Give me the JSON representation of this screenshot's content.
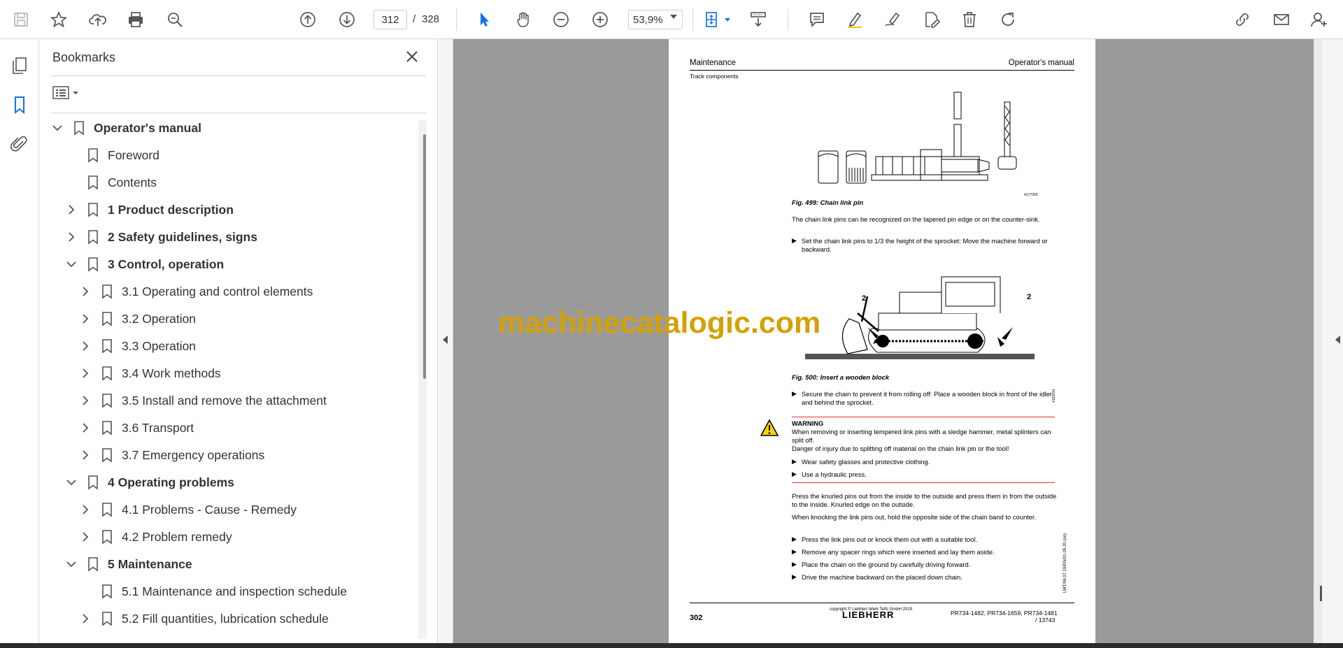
{
  "toolbar": {
    "page_current": "312",
    "page_separator": "/",
    "page_total": "328",
    "zoom": "53,9%"
  },
  "panel": {
    "title": "Bookmarks"
  },
  "bookmarks": [
    {
      "label": "Operator's manual",
      "level": 0,
      "expander": "expanded",
      "bold": true
    },
    {
      "label": "Foreword",
      "level": 1,
      "expander": "none",
      "bold": false
    },
    {
      "label": "Contents",
      "level": 1,
      "expander": "none",
      "bold": false
    },
    {
      "label": "1 Product description",
      "level": 1,
      "expander": "collapsed",
      "bold": true
    },
    {
      "label": "2 Safety guidelines, signs",
      "level": 1,
      "expander": "collapsed",
      "bold": true
    },
    {
      "label": "3 Control, operation",
      "level": 1,
      "expander": "expanded",
      "bold": true
    },
    {
      "label": "3.1 Operating and control elements",
      "level": 2,
      "expander": "collapsed",
      "bold": false
    },
    {
      "label": "3.2 Operation",
      "level": 2,
      "expander": "collapsed",
      "bold": false
    },
    {
      "label": "3.3 Operation",
      "level": 2,
      "expander": "collapsed",
      "bold": false
    },
    {
      "label": "3.4 Work methods",
      "level": 2,
      "expander": "collapsed",
      "bold": false
    },
    {
      "label": "3.5 Install and remove the attachment",
      "level": 2,
      "expander": "collapsed",
      "bold": false
    },
    {
      "label": "3.6 Transport",
      "level": 2,
      "expander": "collapsed",
      "bold": false
    },
    {
      "label": "3.7 Emergency operations",
      "level": 2,
      "expander": "collapsed",
      "bold": false
    },
    {
      "label": "4 Operating problems",
      "level": 1,
      "expander": "expanded",
      "bold": true
    },
    {
      "label": "4.1 Problems - Cause - Remedy",
      "level": 2,
      "expander": "collapsed",
      "bold": false
    },
    {
      "label": "4.2 Problem remedy",
      "level": 2,
      "expander": "collapsed",
      "bold": false
    },
    {
      "label": "5 Maintenance",
      "level": 1,
      "expander": "expanded",
      "bold": true
    },
    {
      "label": "5.1 Maintenance and inspection schedule",
      "level": 2,
      "expander": "none",
      "bold": false
    },
    {
      "label": "5.2 Fill quantities, lubrication schedule",
      "level": 2,
      "expander": "collapsed",
      "bold": false
    }
  ],
  "document": {
    "header_left": "Maintenance",
    "header_right": "Operator's manual",
    "subheader": "Track components",
    "fig1_code": "4177059",
    "fig1_caption": "Fig. 499: Chain link pin",
    "para1": "The chain link pins can be recognized on the tapered pin edge or on the counter-sink.",
    "step1": "Set the chain link pins to 1/3 the height of the sprocket: Move the machine forward or backward.",
    "fig2_label_left": "2",
    "fig2_label_right": "2",
    "fig2_code": "4193014",
    "fig2_caption": "Fig. 500: Insert a wooden block",
    "step2": "Secure the chain to prevent it from rolling off: Place a wooden block in front of the idler and behind the sprocket.",
    "warning_title": "WARNING",
    "warning_text": "When removing or inserting tempered link pins with a sledge hammer, metal splinters can split off.",
    "warning_danger": "Danger of injury due to splitting off material on the chain link pin or the tool!",
    "warning_step1": "Wear safety glasses and protective clothing.",
    "warning_step2": "Use a hydraulic press.",
    "para2": "Press the knurled pins out from the inside to the outside and press them in from the outside to the inside. Knurled edge on the outside.",
    "para3": "When knocking the link pins out, hold the opposite side of the chain band to counter.",
    "step3": "Press the link pins out or knock them out with a suitable tool.",
    "step4": "Remove any spacer rings which were inserted and lay them aside.",
    "step5": "Place the chain on the ground by carefully driving forward.",
    "step6": "Drive the machine backward on the placed down chain.",
    "side_code": "LWT/06.07.19/EN/01-05.20 (en)",
    "footer_page": "302",
    "footer_copyright": "copyright © Liebherr-Werk Telfs GmbH 2019",
    "footer_brand": "LIEBHERR",
    "footer_models": "PR734-1482, PR734-1659, PR734-1481",
    "footer_models2": "/ 13743"
  },
  "watermark": "machinecatalogic.com",
  "colors": {
    "accent_blue": "#1473e6",
    "watermark": "#d4a106",
    "warning_red": "#e0312b"
  },
  "icons": [
    "save-icon",
    "star-icon",
    "upload-icon",
    "print-icon",
    "zoom-search-icon",
    "arrow-up-circle-icon",
    "arrow-down-circle-icon",
    "select-pointer-icon",
    "hand-icon",
    "zoom-out-icon",
    "zoom-in-icon",
    "fit-page-icon",
    "scroll-mode-icon",
    "comment-icon",
    "highlight-icon",
    "sign-icon",
    "edit-pdf-icon",
    "delete-icon",
    "rotate-icon",
    "share-link-icon",
    "mail-icon",
    "add-user-icon"
  ]
}
